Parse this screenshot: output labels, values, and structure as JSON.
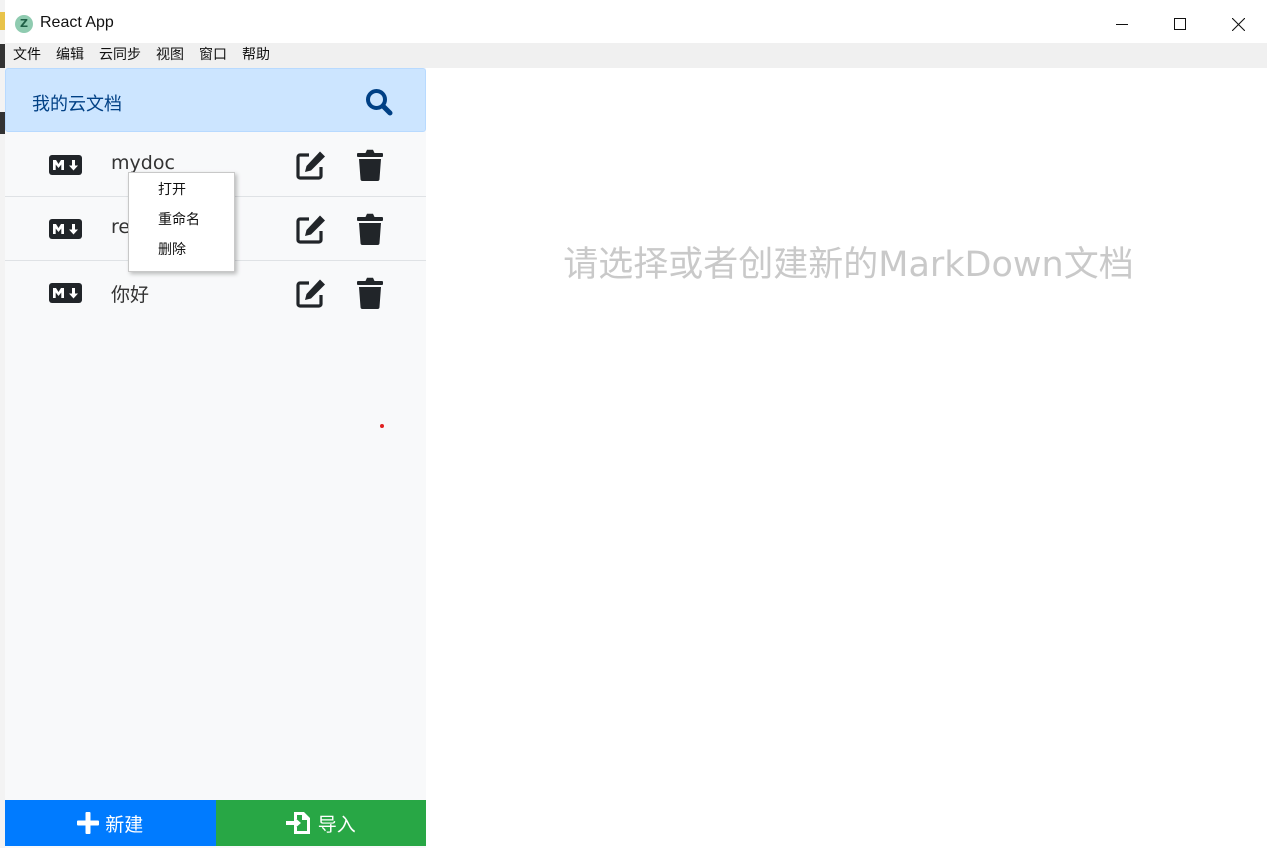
{
  "window": {
    "title": "React App",
    "app_icon_letter": "Z"
  },
  "menubar": {
    "items": [
      "文件",
      "编辑",
      "云同步",
      "视图",
      "窗口",
      "帮助"
    ]
  },
  "sidebar": {
    "search": {
      "title": "我的云文档",
      "icon": "search-icon"
    },
    "files": [
      {
        "name": "mydoc",
        "icon": "markdown-icon"
      },
      {
        "name": "re",
        "icon": "markdown-icon"
      },
      {
        "name": "你好",
        "icon": "markdown-icon"
      }
    ],
    "row_actions": {
      "edit_icon": "edit-icon",
      "delete_icon": "trash-icon"
    },
    "buttons": {
      "new_label": "新建",
      "import_label": "导入"
    }
  },
  "context_menu": {
    "items": [
      "打开",
      "重命名",
      "删除"
    ]
  },
  "main": {
    "placeholder": "请选择或者创建新的MarkDown文档"
  },
  "colors": {
    "search_header_bg": "#cce5ff",
    "search_text": "#004085",
    "new_button": "#007bff",
    "import_button": "#28a745",
    "sidebar_bg": "#f8f9fa",
    "placeholder_text": "#c9c9c9"
  }
}
